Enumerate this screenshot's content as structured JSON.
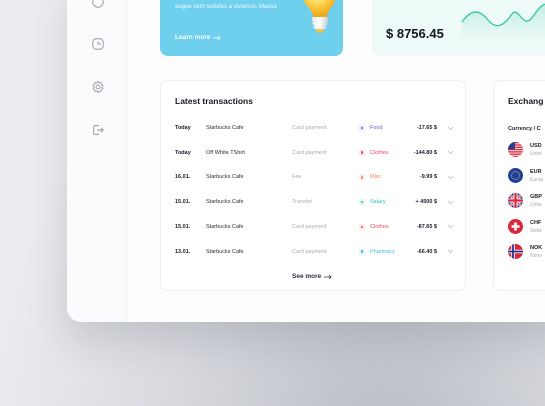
{
  "sidebar": {
    "icons": [
      "wallet-icon",
      "pie-chart-icon",
      "settings-icon",
      "logout-icon"
    ]
  },
  "promo": {
    "text": "augue sem sodales a vivamus. Massa",
    "link_label": "Learn more",
    "bg_color": "#6fd0ee"
  },
  "balance": {
    "amount": "$ 8756.45",
    "wave_color": "#3fc9a9"
  },
  "transactions": {
    "title": "Latest transactions",
    "rows": [
      {
        "date": "Today",
        "name": "Starbucks Cafe",
        "type": "Card payment",
        "category": "Food",
        "cat_color": "#6b5ce7",
        "cat_bg": "#ecebfb",
        "amount": "-17.65 $"
      },
      {
        "date": "Today",
        "name": "Off White TShirt",
        "type": "Card payment",
        "category": "Clothes",
        "cat_color": "#ef4f5a",
        "cat_bg": "#fde8ea",
        "amount": "-144.80 $"
      },
      {
        "date": "16.01.",
        "name": "Starbucks Cafe",
        "type": "Fee",
        "category": "Misc",
        "cat_color": "#f48a64",
        "cat_bg": "#fdede6",
        "amount": "-9.99 $"
      },
      {
        "date": "15.01.",
        "name": "Starbucks Cafe",
        "type": "Transfer",
        "category": "Salary",
        "cat_color": "#2fc1a4",
        "cat_bg": "#e2f7f2",
        "amount": "+ 4500 $"
      },
      {
        "date": "15.01.",
        "name": "Starbucks Cafe",
        "type": "Card payment",
        "category": "Clothes",
        "cat_color": "#ef4f5a",
        "cat_bg": "#fde8ea",
        "amount": "-87.65 $"
      },
      {
        "date": "13.01.",
        "name": "Starbucks Cafe",
        "type": "Card payment",
        "category": "Pharmacy",
        "cat_color": "#40b8e6",
        "cat_bg": "#e3f4fb",
        "amount": "-66.40 $"
      }
    ],
    "see_more_label": "See more"
  },
  "exchange": {
    "title": "Exchang",
    "subheader": "Currency / C",
    "rows": [
      {
        "code": "USD",
        "name": "Unite",
        "flag": "us-flag-icon"
      },
      {
        "code": "EUR",
        "name": "Europ",
        "flag": "eu-flag-icon"
      },
      {
        "code": "GBP",
        "name": "Unite",
        "flag": "gb-flag-icon"
      },
      {
        "code": "CHF",
        "name": "Switz",
        "flag": "ch-flag-icon"
      },
      {
        "code": "NOK",
        "name": "Norw",
        "flag": "no-flag-icon"
      }
    ]
  }
}
